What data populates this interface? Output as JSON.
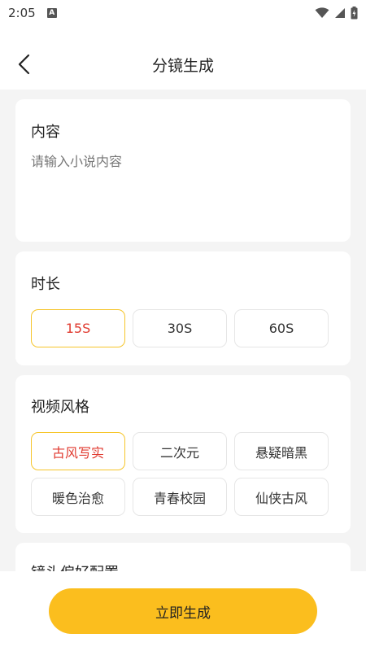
{
  "status_bar": {
    "time": "2:05",
    "notification_badge": "A"
  },
  "header": {
    "title": "分镜生成"
  },
  "content_card": {
    "title": "内容",
    "placeholder": "请输入小说内容"
  },
  "duration_card": {
    "title": "时长",
    "options": [
      "15S",
      "30S",
      "60S"
    ],
    "selected": "15S"
  },
  "style_card": {
    "title": "视频风格",
    "options": [
      "古风写实",
      "二次元",
      "悬疑暗黑",
      "暖色治愈",
      "青春校园",
      "仙侠古风"
    ],
    "selected": "古风写实"
  },
  "camera_card": {
    "title": "镜头偏好配置"
  },
  "actions": {
    "generate_label": "立即生成"
  },
  "colors": {
    "accent": "#fbbe1e",
    "selected_border": "#f6c52a",
    "selected_text": "#e03a2f",
    "page_background": "#f4f4f4"
  }
}
